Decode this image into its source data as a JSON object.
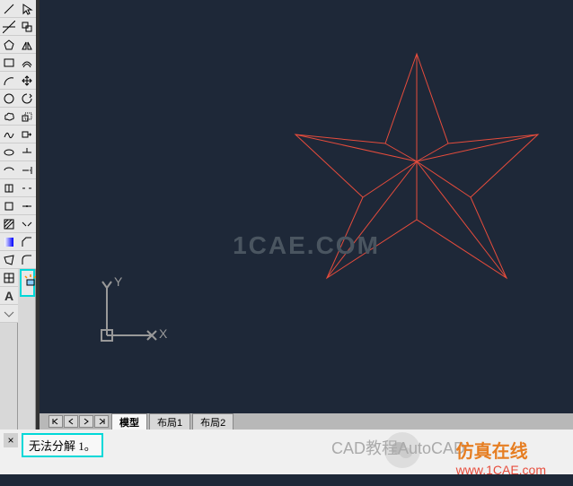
{
  "watermark_center": "1CAE.COM",
  "ucs": {
    "x_label": "X",
    "y_label": "Y"
  },
  "tabs": {
    "model": "模型",
    "layout1": "布局1",
    "layout2": "布局2"
  },
  "command": {
    "close_symbol": "×",
    "text": "无法分解 1。"
  },
  "overlay": {
    "cad_text": "CAD教程AutoCAD",
    "sim_text": "仿真在线",
    "url_text": "www.1CAE.com"
  },
  "tools": {
    "text_label": "A"
  },
  "chart_data": {
    "type": "drawing",
    "description": "Red five-pointed star with inner lines connecting center to vertices",
    "star_center": [
      160,
      130
    ],
    "outer_radius": 130,
    "color": "#e74c3c"
  }
}
